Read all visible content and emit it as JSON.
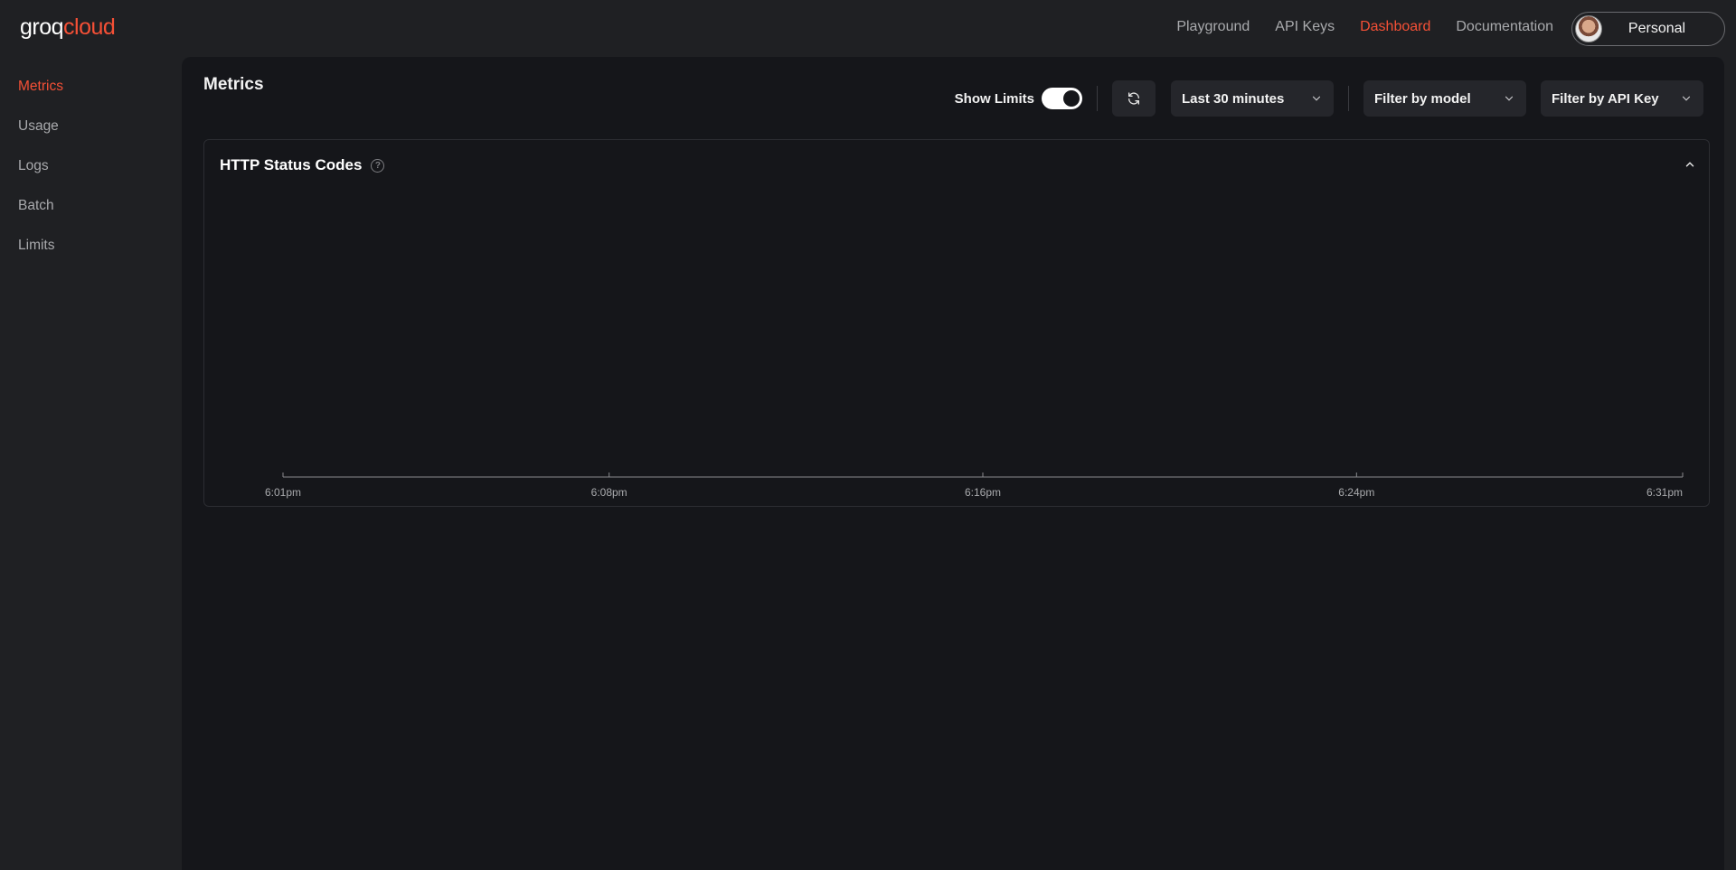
{
  "brand": {
    "part1": "groq",
    "part2": "cloud",
    "accent": "#f55036"
  },
  "nav": [
    {
      "label": "Playground",
      "active": false
    },
    {
      "label": "API Keys",
      "active": false
    },
    {
      "label": "Dashboard",
      "active": true
    },
    {
      "label": "Documentation",
      "active": false
    }
  ],
  "account": {
    "label": "Personal"
  },
  "sidebar": {
    "items": [
      {
        "label": "Metrics",
        "active": true
      },
      {
        "label": "Usage",
        "active": false
      },
      {
        "label": "Logs",
        "active": false
      },
      {
        "label": "Batch",
        "active": false
      },
      {
        "label": "Limits",
        "active": false
      }
    ]
  },
  "page": {
    "title": "Metrics"
  },
  "controls": {
    "show_limits_label": "Show Limits",
    "show_limits_on": true,
    "time_range": "Last 30 minutes",
    "model_filter": "Filter by model",
    "api_key_filter": "Filter by API Key",
    "refresh_icon": "refresh-icon"
  },
  "chart_data": {
    "type": "line",
    "title": "HTTP Status Codes",
    "x_ticks": [
      "6:01pm",
      "6:08pm",
      "6:16pm",
      "6:24pm",
      "6:31pm"
    ],
    "series": []
  }
}
